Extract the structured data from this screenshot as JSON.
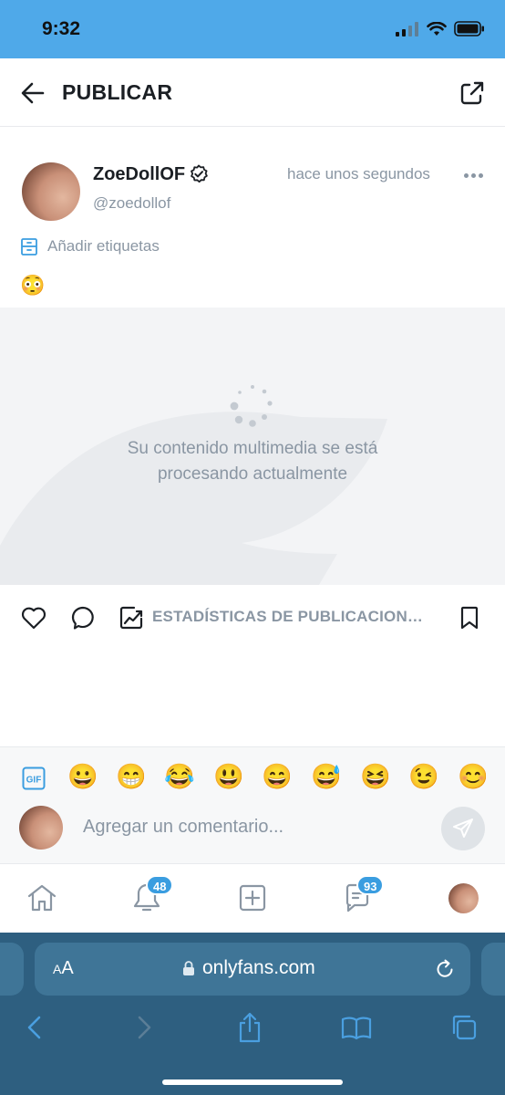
{
  "status": {
    "time": "9:32"
  },
  "header": {
    "title": "PUBLICAR"
  },
  "post": {
    "author_name": "ZoeDollOF",
    "handle": "@zoedollof",
    "time_ago": "hace unos segundos",
    "tags_label": "Añadir etiquetas",
    "text": "😳",
    "processing_message": "Su contenido multimedia se está procesando actualmente"
  },
  "actions": {
    "stats_label": "ESTADÍSTICAS DE PUBLICACION…"
  },
  "comment": {
    "emojis": [
      "😀",
      "😁",
      "😂",
      "😃",
      "😄",
      "😅",
      "😆",
      "😉",
      "😊"
    ],
    "placeholder": "Agregar un comentario...",
    "value": ""
  },
  "nav": {
    "notifications_badge": "48",
    "messages_badge": "93"
  },
  "browser": {
    "aa_label": "AA",
    "url": "onlyfans.com"
  },
  "colors": {
    "accent": "#00aff0",
    "statusbar": "#4fa9e9",
    "muted": "#8a96a3",
    "safari": "#2e5f80",
    "badge": "#3a9de0"
  },
  "icons": [
    "back-arrow-icon",
    "share-icon",
    "verified-icon",
    "more-icon",
    "tag-icon",
    "spinner-icon",
    "heart-icon",
    "comment-icon",
    "stats-icon",
    "bookmark-icon",
    "gif-icon",
    "send-icon",
    "home-icon",
    "bell-icon",
    "plus-square-icon",
    "messages-icon",
    "lock-icon",
    "reload-icon",
    "safari-back-icon",
    "safari-forward-icon",
    "safari-share-icon",
    "bookmarks-icon",
    "tabs-icon"
  ]
}
